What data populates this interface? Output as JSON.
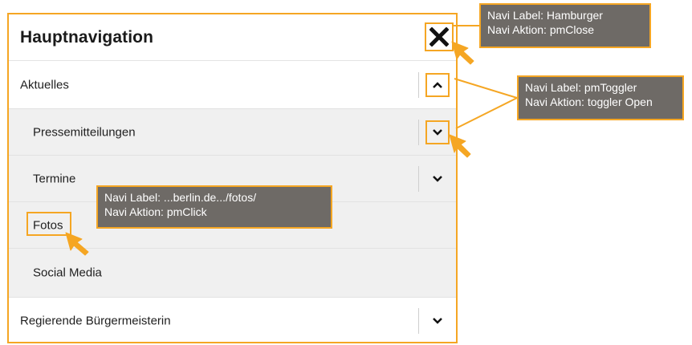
{
  "header": {
    "title": "Hauptnavigation",
    "close_icon": "close-x-icon"
  },
  "menu": {
    "items": [
      {
        "label": "Aktuelles",
        "level": 1,
        "toggle_icon": "chevron-up-icon",
        "expanded": true
      },
      {
        "label": "Pressemitteilungen",
        "level": 2,
        "toggle_icon": "chevron-down-icon"
      },
      {
        "label": "Termine",
        "level": 2,
        "toggle_icon": "chevron-down-icon"
      },
      {
        "label": "Fotos",
        "level": 2
      },
      {
        "label": "Social Media",
        "level": 2
      },
      {
        "label": "Regierende Bürgermeisterin",
        "level": 1,
        "toggle_icon": "chevron-down-icon"
      }
    ]
  },
  "annotations": {
    "hamburger": {
      "line1": "Navi Label: Hamburger",
      "line2": "Navi Aktion: pmClose"
    },
    "toggler": {
      "line1": "Navi Label: pmToggler",
      "line2": "Navi Aktion: toggler Open"
    },
    "fotos": {
      "line1": "Navi Label: ...berlin.de.../fotos/",
      "line2": "Navi Aktion: pmClick"
    }
  },
  "colors": {
    "highlight": "#f5a623",
    "callout_bg": "#6e6a66",
    "submenu_bg": "#f0f0f0"
  }
}
